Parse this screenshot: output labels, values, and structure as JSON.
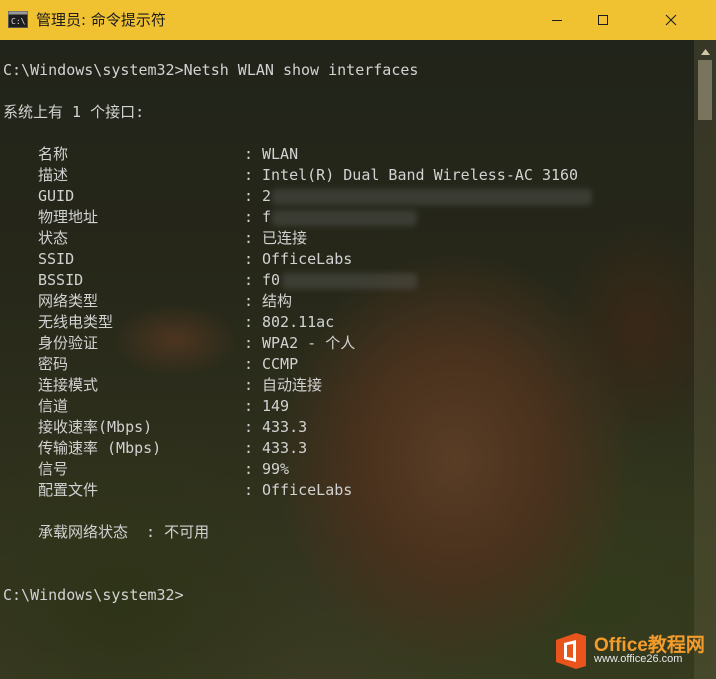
{
  "window": {
    "title": "管理员: 命令提示符",
    "icon": "cmd-icon",
    "controls": [
      "minimize-icon",
      "maximize-icon",
      "close-icon"
    ],
    "titlebar_color": "#f0c232"
  },
  "console": {
    "command_line": "C:\\Windows\\system32>Netsh WLAN show interfaces",
    "summary": "系统上有 1 个接口:",
    "separator": ":",
    "fields": [
      {
        "label": "名称",
        "value": "WLAN"
      },
      {
        "label": "描述",
        "value": "Intel(R) Dual Band Wireless-AC 3160"
      },
      {
        "label": "GUID",
        "value": "2"
      },
      {
        "label": "物理地址",
        "value": "f"
      },
      {
        "label": "状态",
        "value": "已连接"
      },
      {
        "label": "SSID",
        "value": "OfficeLabs"
      },
      {
        "label": "BSSID",
        "value": "f0"
      },
      {
        "label": "网络类型",
        "value": "结构"
      },
      {
        "label": "无线电类型",
        "value": "802.11ac"
      },
      {
        "label": "身份验证",
        "value": "WPA2 - 个人"
      },
      {
        "label": "密码",
        "value": "CCMP"
      },
      {
        "label": "连接模式",
        "value": "自动连接"
      },
      {
        "label": "信道",
        "value": "149"
      },
      {
        "label": "接收速率(Mbps)",
        "value": "433.3"
      },
      {
        "label": "传输速率 (Mbps)",
        "value": "433.3"
      },
      {
        "label": "信号",
        "value": "99%"
      },
      {
        "label": "配置文件",
        "value": "OfficeLabs"
      }
    ],
    "hosted_network": "承载网络状态  : 不可用",
    "prompt": "C:\\Windows\\system32>"
  },
  "watermark": {
    "brand": "Office教程网",
    "url": "www.office26.com",
    "brand_color": "#f39c2c",
    "badge_color": "#e8541c"
  }
}
